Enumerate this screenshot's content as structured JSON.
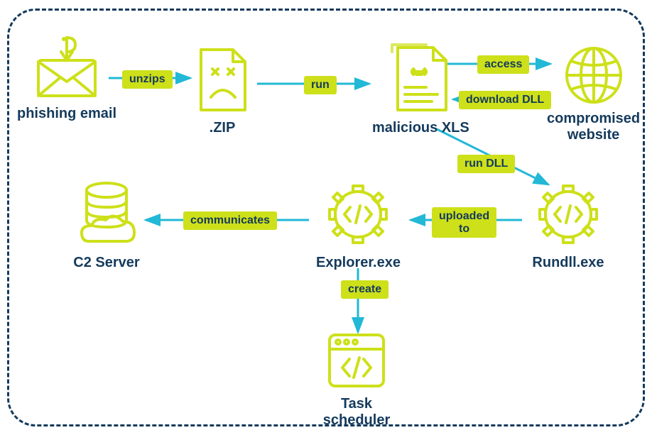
{
  "nodes": {
    "phishing": "phishing email",
    "zip": ".ZIP",
    "xls": "malicious XLS",
    "website": "compromised\nwebsite",
    "rundll": "Rundll.exe",
    "explorer": "Explorer.exe",
    "c2": "C2 Server",
    "task": "Task\nscheduler"
  },
  "edges": {
    "unzips": "unzips",
    "run": "run",
    "access": "access",
    "download": "download DLL",
    "rundll": "run DLL",
    "uploaded": "uploaded\nto",
    "communicates": "communicates",
    "create": "create"
  }
}
